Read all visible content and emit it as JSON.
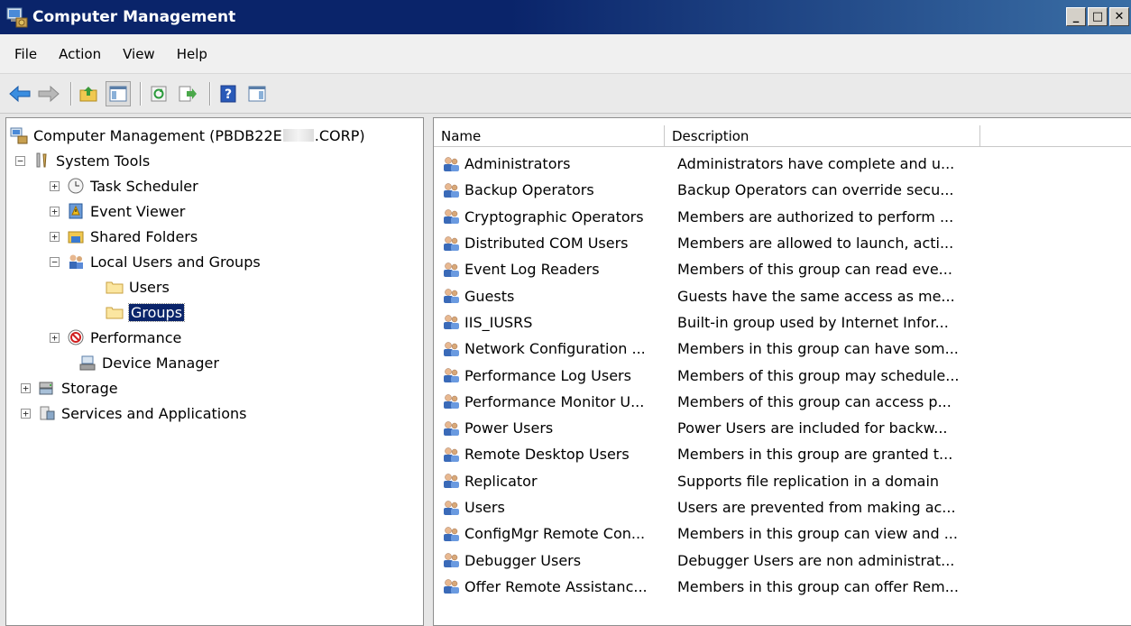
{
  "window": {
    "title": "Computer Management",
    "buttons": {
      "minimize": "_",
      "maximize": "□",
      "close": "✕"
    }
  },
  "menu": [
    "File",
    "Action",
    "View",
    "Help"
  ],
  "toolbar": {
    "icons": [
      "back-arrow-icon",
      "forward-arrow-icon",
      "up-folder-icon",
      "show-hide-console-tree-icon",
      "refresh-icon",
      "export-list-icon",
      "help-icon",
      "show-hide-action-pane-icon"
    ]
  },
  "tree": {
    "root": {
      "label_prefix": "Computer Management (PBDB22E",
      "label_suffix": ".CORP)"
    },
    "system_tools": "System Tools",
    "task_scheduler": "Task Scheduler",
    "event_viewer": "Event Viewer",
    "shared_folders": "Shared Folders",
    "local_users_groups": "Local Users and Groups",
    "users": "Users",
    "groups": "Groups",
    "performance": "Performance",
    "device_manager": "Device Manager",
    "storage": "Storage",
    "services_apps": "Services and Applications"
  },
  "list": {
    "columns": [
      "Name",
      "Description"
    ],
    "rows": [
      {
        "name": "Administrators",
        "description": "Administrators have complete and u..."
      },
      {
        "name": "Backup Operators",
        "description": "Backup Operators can override secu..."
      },
      {
        "name": "Cryptographic Operators",
        "description": "Members are authorized to perform ..."
      },
      {
        "name": "Distributed COM Users",
        "description": "Members are allowed to launch, acti..."
      },
      {
        "name": "Event Log Readers",
        "description": "Members of this group can read eve..."
      },
      {
        "name": "Guests",
        "description": "Guests have the same access as me..."
      },
      {
        "name": "IIS_IUSRS",
        "description": "Built-in group used by Internet Infor..."
      },
      {
        "name": "Network Configuration ...",
        "description": "Members in this group can have som..."
      },
      {
        "name": "Performance Log Users",
        "description": "Members of this group may schedule..."
      },
      {
        "name": "Performance Monitor U...",
        "description": "Members of this group can access p..."
      },
      {
        "name": "Power Users",
        "description": "Power Users are included for backw..."
      },
      {
        "name": "Remote Desktop Users",
        "description": "Members in this group are granted t..."
      },
      {
        "name": "Replicator",
        "description": "Supports file replication in a domain"
      },
      {
        "name": "Users",
        "description": "Users are prevented from making ac..."
      },
      {
        "name": "ConfigMgr Remote Con...",
        "description": "Members in this group can view and ..."
      },
      {
        "name": "Debugger Users",
        "description": "Debugger Users are non administrat..."
      },
      {
        "name": "Offer Remote Assistanc...",
        "description": "Members in this group can offer Rem..."
      }
    ]
  }
}
